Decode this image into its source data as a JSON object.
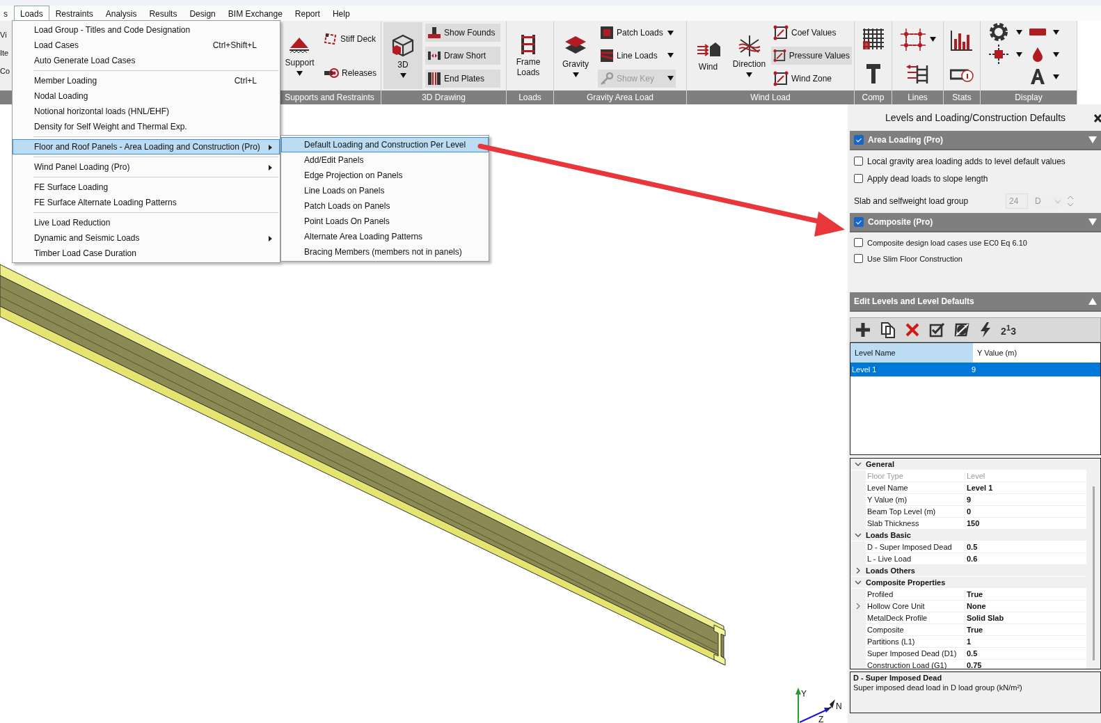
{
  "menu_bar": {
    "items": [
      {
        "label": "s",
        "selected": false
      },
      {
        "label": "Loads",
        "selected": true
      },
      {
        "label": "Restraints",
        "selected": false
      },
      {
        "label": "Analysis",
        "selected": false
      },
      {
        "label": "Results",
        "selected": false
      },
      {
        "label": "Design",
        "selected": false
      },
      {
        "label": "BIM Exchange",
        "selected": false
      },
      {
        "label": "Report",
        "selected": false
      },
      {
        "label": "Help",
        "selected": false
      }
    ]
  },
  "ribbon": {
    "cut_labels": [
      "Vi",
      "Ite",
      "Co"
    ],
    "groups": [
      {
        "label": "Supports and Restraints",
        "buttons": [
          {
            "label": "Support",
            "dropdown": true,
            "on": false
          },
          {
            "label": "Stiff Deck",
            "on": false
          },
          {
            "label": "Releases",
            "on": false
          }
        ]
      },
      {
        "label": "3D Drawing",
        "buttons": [
          {
            "label": "3D",
            "dropdown": true,
            "on": true
          },
          {
            "label": "Show Founds",
            "on": true
          },
          {
            "label": "Draw Short",
            "on": true
          },
          {
            "label": "End Plates",
            "on": true
          }
        ]
      },
      {
        "label": "Loads",
        "buttons": [
          {
            "label": "Frame Loads",
            "on": false
          }
        ]
      },
      {
        "label": "Gravity Area Load",
        "buttons": [
          {
            "label": "Gravity",
            "dropdown": true,
            "on": false
          },
          {
            "label": "Patch Loads",
            "dropdown": true,
            "on": false,
            "disabled": false
          },
          {
            "label": "Line Loads",
            "dropdown": true,
            "on": false,
            "disabled": false
          },
          {
            "label": "Show Key",
            "dropdown": true,
            "on": true,
            "disabled": true
          }
        ]
      },
      {
        "label": "Wind Load",
        "buttons": [
          {
            "label": "Wind",
            "dropdown": false,
            "on": false
          },
          {
            "label": "Direction",
            "dropdown": true,
            "on": false
          },
          {
            "label": "Coef Values",
            "on": false
          },
          {
            "label": "Pressure Values",
            "on": true
          },
          {
            "label": "Wind Zone",
            "on": false
          }
        ]
      },
      {
        "label": "Comp"
      },
      {
        "label": "Lines"
      },
      {
        "label": "Stats"
      },
      {
        "label": "Display"
      }
    ]
  },
  "loads_menu": {
    "items": [
      {
        "kind": "item",
        "label": "Load Group - Titles and Code Designation",
        "has_submenu": false,
        "selected": false
      },
      {
        "kind": "item",
        "label": "Load Cases",
        "shortcut": "Ctrl+Shift+L",
        "has_submenu": false,
        "selected": false
      },
      {
        "kind": "item",
        "label": "Auto Generate Load Cases",
        "has_submenu": false,
        "selected": false
      },
      {
        "kind": "separator"
      },
      {
        "kind": "item",
        "label": "Member Loading",
        "shortcut": "Ctrl+L",
        "has_submenu": false,
        "selected": false
      },
      {
        "kind": "item",
        "label": "Nodal Loading",
        "has_submenu": false,
        "selected": false
      },
      {
        "kind": "item",
        "label": "Notional horizontal loads (HNL/EHF)",
        "has_submenu": false,
        "selected": false
      },
      {
        "kind": "item",
        "label": "Density for Self Weight and Thermal Exp.",
        "has_submenu": false,
        "selected": false
      },
      {
        "kind": "separator"
      },
      {
        "kind": "item",
        "label": "Floor and Roof Panels - Area Loading and Construction (Pro)",
        "has_submenu": true,
        "selected": true
      },
      {
        "kind": "separator"
      },
      {
        "kind": "item",
        "label": "Wind Panel Loading (Pro)",
        "has_submenu": true,
        "selected": false
      },
      {
        "kind": "separator"
      },
      {
        "kind": "item",
        "label": "FE Surface Loading",
        "has_submenu": false,
        "selected": false
      },
      {
        "kind": "item",
        "label": "FE Surface Alternate Loading Patterns",
        "has_submenu": false,
        "selected": false
      },
      {
        "kind": "separator"
      },
      {
        "kind": "item",
        "label": "Live Load Reduction",
        "has_submenu": false,
        "selected": false
      },
      {
        "kind": "item",
        "label": "Dynamic and Seismic Loads",
        "has_submenu": true,
        "selected": false
      },
      {
        "kind": "item",
        "label": "Timber Load Case Duration",
        "has_submenu": false,
        "selected": false
      }
    ]
  },
  "panels_submenu": {
    "items": [
      {
        "label": "Default Loading and Construction Per Level",
        "selected": true
      },
      {
        "label": "Add/Edit Panels",
        "selected": false
      },
      {
        "label": "Edge Projection on Panels",
        "selected": false
      },
      {
        "label": "Line Loads on Panels",
        "selected": false
      },
      {
        "label": "Patch Loads on Panels",
        "selected": false
      },
      {
        "label": "Point Loads On Panels",
        "selected": false
      },
      {
        "label": "Alternate Area Loading Patterns",
        "selected": false
      },
      {
        "label": "Bracing Members (members not in panels)",
        "selected": false
      }
    ]
  },
  "axes": {
    "y": "Y",
    "z": "Z",
    "n": "N"
  },
  "side_panel": {
    "title": "Levels and Loading/Construction Defaults",
    "area_loading": {
      "label": "Area Loading (Pro)",
      "checked": true,
      "pointing_up": false,
      "options": [
        {
          "label": "Local gravity area loading adds to level default values",
          "checked": false
        },
        {
          "label": "Apply dead loads to slope length",
          "checked": false
        }
      ],
      "load_group": {
        "label": "Slab and selfweight load group",
        "number": "24",
        "letter": "D"
      }
    },
    "composite": {
      "label": "Composite (Pro)",
      "checked": true,
      "pointing_up": false,
      "options": [
        {
          "label": "Composite design load cases use EC0 Eq 6.10",
          "checked": false
        },
        {
          "label": "Use Slim Floor Construction",
          "checked": false
        }
      ]
    },
    "edit_levels": {
      "label": "Edit Levels and Level Defaults",
      "pointing_up": true,
      "sort_glyph": "2$^{1}$3",
      "columns": [
        {
          "label": "Level Name",
          "selected": true
        },
        {
          "label": "Y Value (m)",
          "selected": false
        }
      ],
      "rows": [
        {
          "cells": [
            "Level 1",
            "9"
          ],
          "selected": true
        }
      ]
    },
    "properties": [
      {
        "category": "General",
        "expanded": true,
        "rows": [
          {
            "name": "Floor Type",
            "value": "Level",
            "disabled": true,
            "expandable": false
          },
          {
            "name": "Level Name",
            "value": "Level 1",
            "disabled": false,
            "expandable": false
          },
          {
            "name": "Y Value (m)",
            "value": "9",
            "disabled": false,
            "expandable": false
          },
          {
            "name": "Beam Top Level (m)",
            "value": "0",
            "disabled": false,
            "expandable": false
          },
          {
            "name": "Slab Thickness",
            "value": "150",
            "disabled": false,
            "expandable": false
          }
        ]
      },
      {
        "category": "Loads Basic",
        "expanded": true,
        "rows": [
          {
            "name": "D - Super Imposed Dead",
            "value": "0.5",
            "disabled": false,
            "expandable": false
          },
          {
            "name": "L - Live Load",
            "value": "0.6",
            "disabled": false,
            "expandable": false
          }
        ]
      },
      {
        "category": "Loads Others",
        "expanded": false
      },
      {
        "category": "Composite Properties",
        "expanded": true,
        "rows": [
          {
            "name": "Profiled",
            "value": "True",
            "disabled": false,
            "expandable": false
          },
          {
            "name": "Hollow Core Unit",
            "value": "None",
            "disabled": false,
            "expandable": true
          },
          {
            "name": "MetalDeck Profile",
            "value": "Solid Slab",
            "disabled": false,
            "expandable": false
          },
          {
            "name": "Composite",
            "value": "True",
            "disabled": false,
            "expandable": false
          },
          {
            "name": "Partitions (L1)",
            "value": "1",
            "disabled": false,
            "expandable": false
          },
          {
            "name": "Super Imposed Dead (D1)",
            "value": "0.5",
            "disabled": false,
            "expandable": false
          },
          {
            "name": "Construction Load (G1)",
            "value": "0.75",
            "disabled": false,
            "expandable": false
          }
        ]
      }
    ],
    "description": {
      "title": "D - Super Imposed Dead",
      "text": "Super imposed dead load in D load group (kN/m²)"
    }
  }
}
